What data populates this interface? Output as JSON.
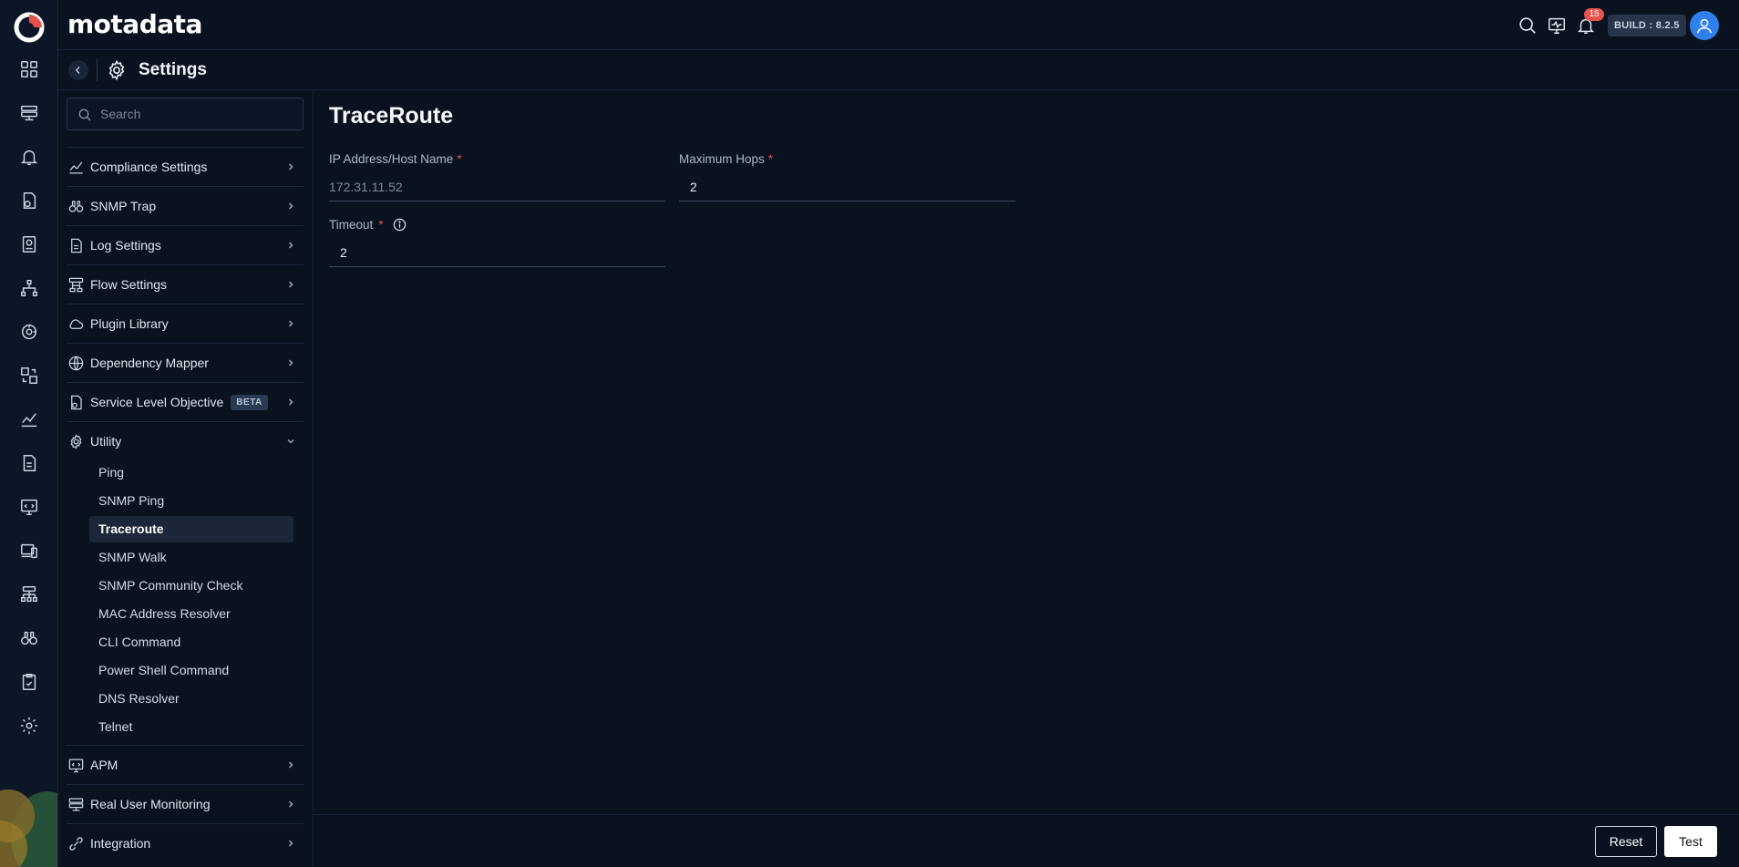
{
  "app": {
    "brand": "motadata",
    "build_label": "BUILD : 8.2.5",
    "notification_count": "15",
    "colors": {
      "accent": "#e5534b",
      "background": "#0a1220",
      "avatar": "#2f80ed"
    }
  },
  "rail_icons": [
    "dashboard-icon",
    "monitor-server-icon",
    "alert-bell-icon",
    "policy-icon",
    "report-icon",
    "topology-icon",
    "discovery-icon",
    "config-icon",
    "metric-explorer-icon",
    "log-icon",
    "apm-icon",
    "devices-icon",
    "network-icon",
    "binoculars-icon",
    "audit-icon",
    "settings-icon"
  ],
  "header": {
    "title": "Settings"
  },
  "sidebar": {
    "search_placeholder": "Search",
    "items": [
      {
        "label": "Compliance Settings",
        "icon": "compliance-icon"
      },
      {
        "label": "SNMP Trap",
        "icon": "binoculars-icon"
      },
      {
        "label": "Log Settings",
        "icon": "log-icon"
      },
      {
        "label": "Flow Settings",
        "icon": "flow-icon"
      },
      {
        "label": "Plugin Library",
        "icon": "cloud-icon"
      },
      {
        "label": "Dependency Mapper",
        "icon": "globe-icon"
      },
      {
        "label": "Service Level Objective",
        "badge": "BETA",
        "icon": "slo-icon"
      },
      {
        "label": "Utility",
        "icon": "gear-cluster-icon",
        "expanded": true
      }
    ],
    "utility_items": [
      "Ping",
      "SNMP Ping",
      "Traceroute",
      "SNMP Walk",
      "SNMP Community Check",
      "MAC Address Resolver",
      "CLI Command",
      "Power Shell Command",
      "DNS Resolver",
      "Telnet"
    ],
    "active_utility": "Traceroute",
    "bottom_items": [
      {
        "label": "APM",
        "icon": "apm-icon"
      },
      {
        "label": "Real User Monitoring",
        "icon": "rum-icon"
      },
      {
        "label": "Integration",
        "icon": "integration-icon"
      }
    ]
  },
  "form": {
    "title": "TraceRoute",
    "ip": {
      "label": "IP Address/Host Name",
      "required": "*",
      "value": "172.31.11.52"
    },
    "hops": {
      "label": "Maximum Hops",
      "required": "*",
      "value": "2"
    },
    "timeout": {
      "label": "Timeout",
      "required": "*",
      "value": "2"
    }
  },
  "footer": {
    "reset_label": "Reset",
    "test_label": "Test"
  }
}
